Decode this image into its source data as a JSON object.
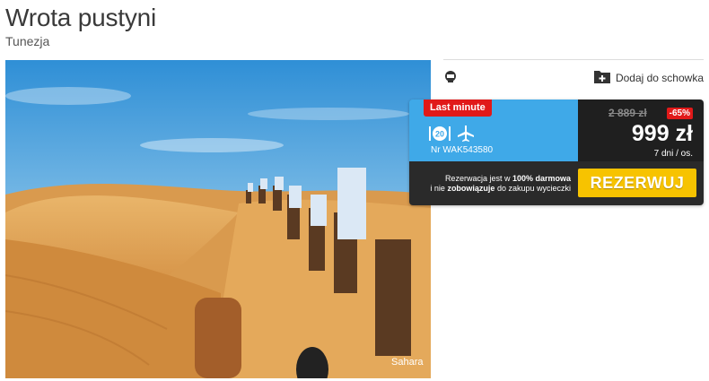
{
  "header": {
    "title": "Wrota pustyni",
    "subtitle": "Tunezja"
  },
  "photo": {
    "caption": "Sahara"
  },
  "actions": {
    "favorite_label": "Dodaj do schowka",
    "left_icon": "chat-icon",
    "favorite_icon": "folder-plus-icon"
  },
  "offer": {
    "badge": "Last minute",
    "board_icon": "board-20-icon",
    "transport_icon": "plane-icon",
    "code": "Nr WAK543580",
    "old_price": "2 889 zł",
    "discount": "-65%",
    "price": "999 zł",
    "duration": "7 dni / os.",
    "info_line1_pre": "Rezerwacja jest w ",
    "info_line1_bold": "100% darmowa",
    "info_line2_pre": "i nie ",
    "info_line2_bold": "zobowiązuje",
    "info_line2_post": " do zakupu wycieczki",
    "book_label": "REZERWUJ"
  },
  "colors": {
    "blue": "#3fa9e8",
    "dark": "#1f1f1f",
    "red": "#e11919",
    "yellow": "#f7c300"
  }
}
